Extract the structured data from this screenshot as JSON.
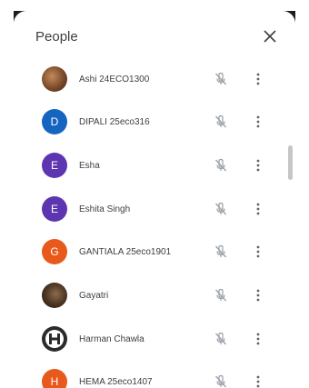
{
  "panel": {
    "title": "People",
    "close_icon": "close-icon"
  },
  "participants": [
    {
      "name": "Ashi 24ECO1300",
      "avatar": {
        "type": "photo",
        "letter": ""
      },
      "mic": "mic-off-icon"
    },
    {
      "name": "DIPALI 25eco316",
      "avatar": {
        "type": "letter",
        "letter": "D",
        "color": "#1565c0"
      },
      "mic": "mic-off-icon"
    },
    {
      "name": "Esha",
      "avatar": {
        "type": "letter",
        "letter": "E",
        "color": "#5e35b1"
      },
      "mic": "mic-off-icon"
    },
    {
      "name": "Eshita Singh",
      "avatar": {
        "type": "letter",
        "letter": "E",
        "color": "#5e35b1"
      },
      "mic": "mic-off-icon"
    },
    {
      "name": "GANTIALA 25eco1901",
      "avatar": {
        "type": "letter",
        "letter": "G",
        "color": "#e8591c"
      },
      "mic": "mic-off-icon"
    },
    {
      "name": "Gayatri",
      "avatar": {
        "type": "photo",
        "letter": ""
      },
      "mic": "mic-off-icon"
    },
    {
      "name": "Harman Chawla",
      "avatar": {
        "type": "photo",
        "letter": ""
      },
      "mic": "mic-off-icon"
    },
    {
      "name": "HEMA 25eco1407",
      "avatar": {
        "type": "letter",
        "letter": "H",
        "color": "#e8591c"
      },
      "mic": "mic-off-icon"
    }
  ]
}
